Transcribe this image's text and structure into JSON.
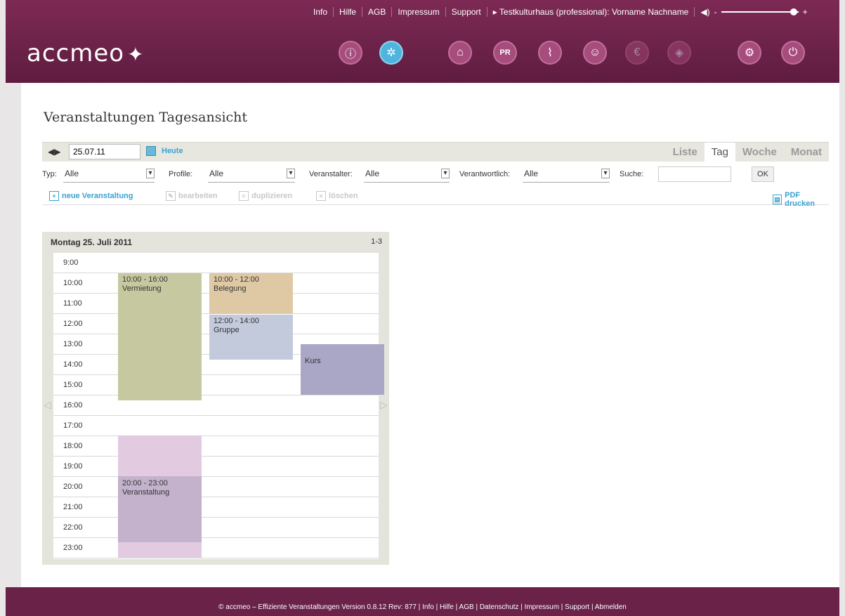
{
  "header": {
    "links": [
      "Info",
      "Hilfe",
      "AGB",
      "Impressum",
      "Support"
    ],
    "user": "▸ Testkulturhaus (professional): Vorname Nachname",
    "logo": "accmeo",
    "icons": [
      {
        "name": "info-icon",
        "glyph": "ⓘ"
      },
      {
        "name": "events-icon",
        "glyph": "✲"
      },
      {
        "name": "home-icon",
        "glyph": "⌂"
      },
      {
        "name": "pr-icon",
        "glyph": "PR"
      },
      {
        "name": "attachment-icon",
        "glyph": "⌇"
      },
      {
        "name": "people-icon",
        "glyph": "☺"
      },
      {
        "name": "euro-icon",
        "glyph": "€"
      },
      {
        "name": "tag-icon",
        "glyph": "◈"
      },
      {
        "name": "settings-icon",
        "glyph": "⚙"
      },
      {
        "name": "power-icon",
        "glyph": "⏻"
      }
    ]
  },
  "page": {
    "title": "Veranstaltungen Tagesansicht"
  },
  "toolbar": {
    "date": "25.07.11",
    "today": "Heute",
    "tabs": [
      "Liste",
      "Tag",
      "Woche",
      "Monat"
    ]
  },
  "filters": {
    "typ_label": "Typ:",
    "typ_value": "Alle",
    "profile_label": "Profile:",
    "profile_value": "Alle",
    "veranstalter_label": "Veranstalter:",
    "veranstalter_value": "Alle",
    "verantwortlich_label": "Verantwortlich:",
    "verantwortlich_value": "Alle",
    "suche_label": "Suche:",
    "ok": "OK"
  },
  "actions": {
    "new": "neue Veranstaltung",
    "edit": "bearbeiten",
    "duplicate": "duplizieren",
    "delete": "löschen",
    "pdf": "PDF drucken"
  },
  "day": {
    "title": "Montag 25. Juli 2011",
    "range": "1-3",
    "hours": [
      "9:00",
      "10:00",
      "11:00",
      "12:00",
      "13:00",
      "14:00",
      "15:00",
      "16:00",
      "17:00",
      "18:00",
      "19:00",
      "20:00",
      "21:00",
      "22:00",
      "23:00"
    ],
    "events": [
      {
        "time": "10:00 - 16:00",
        "title": "Vermietung",
        "color": "#c6c99f"
      },
      {
        "time": "10:00 - 12:00",
        "title": "Belegung",
        "color": "#dfc9a4"
      },
      {
        "time": "12:00 - 14:00",
        "title": "Gruppe",
        "color": "#c3cadb"
      },
      {
        "time": "",
        "title": "Kurs",
        "color": "#a9a6c6"
      },
      {
        "time": "20:00 - 23:00",
        "title": "Veranstaltung",
        "color": "#c4b2cc"
      }
    ]
  },
  "footer": {
    "text": "© accmeo – Effiziente Veranstaltungen Version 0.8.12 Rev: 877 | Info | Hilfe | AGB | Datenschutz | Impressum | Support | Abmelden"
  }
}
